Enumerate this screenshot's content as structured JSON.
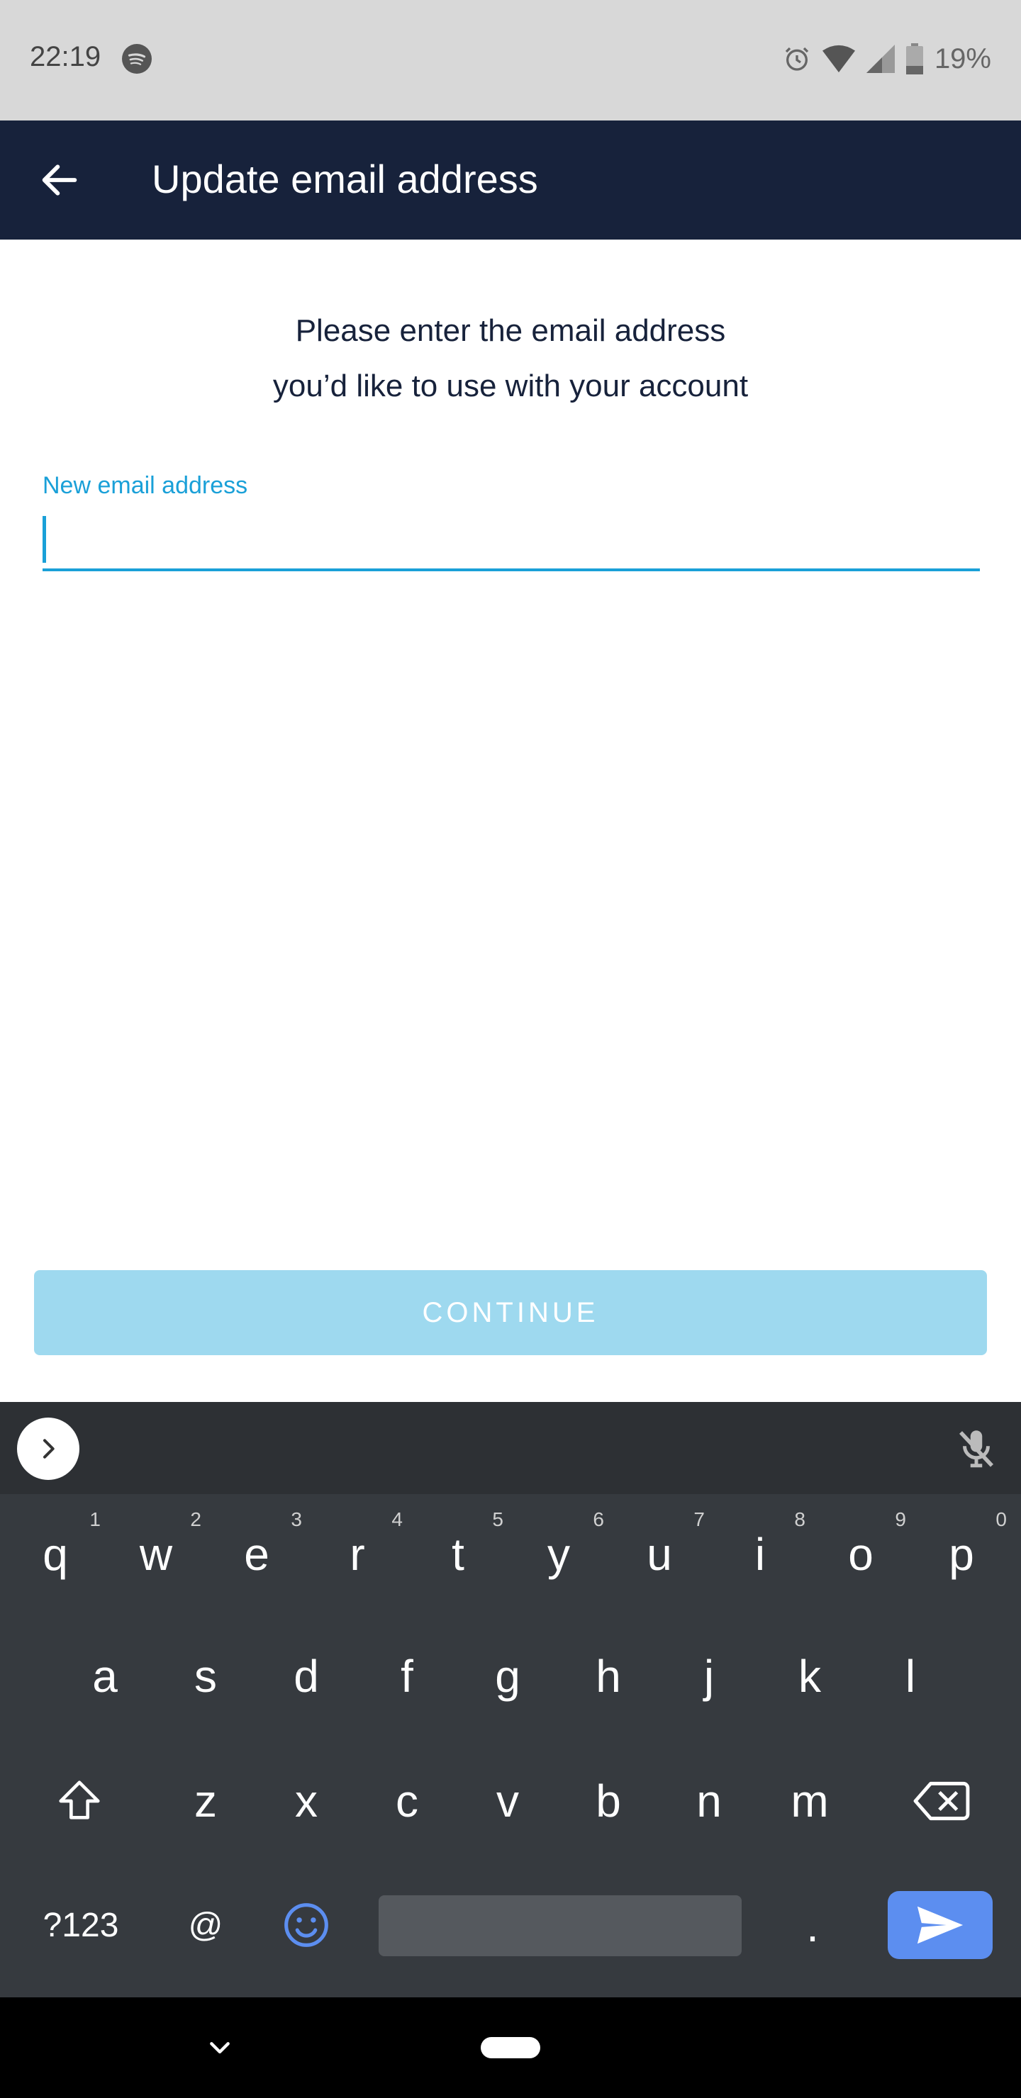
{
  "status_bar": {
    "time": "22:19",
    "battery": "19%",
    "icons": [
      "spotify-icon",
      "alarm-icon",
      "wifi-icon",
      "signal-icon",
      "battery-icon"
    ]
  },
  "app_bar": {
    "title": "Update email address",
    "back_icon": "arrow-back-icon"
  },
  "form": {
    "instruction_line1": "Please enter the email address",
    "instruction_line2": "you’d like to use with your account",
    "email_label": "New email address",
    "email_value": "",
    "continue_label": "CONTINUE"
  },
  "keyboard": {
    "row1": [
      {
        "key": "q",
        "hint": "1"
      },
      {
        "key": "w",
        "hint": "2"
      },
      {
        "key": "e",
        "hint": "3"
      },
      {
        "key": "r",
        "hint": "4"
      },
      {
        "key": "t",
        "hint": "5"
      },
      {
        "key": "y",
        "hint": "6"
      },
      {
        "key": "u",
        "hint": "7"
      },
      {
        "key": "i",
        "hint": "8"
      },
      {
        "key": "o",
        "hint": "9"
      },
      {
        "key": "p",
        "hint": "0"
      }
    ],
    "row2": [
      "a",
      "s",
      "d",
      "f",
      "g",
      "h",
      "j",
      "k",
      "l"
    ],
    "row3": [
      "z",
      "x",
      "c",
      "v",
      "b",
      "n",
      "m"
    ],
    "row4": {
      "symbols": "?123",
      "at": "@",
      "period": "."
    }
  },
  "colors": {
    "app_bar": "#17223b",
    "accent": "#1aa0d8",
    "button_disabled": "#9ed9ef",
    "keyboard_bg": "#363a3f",
    "send_key": "#5c8ef0"
  }
}
